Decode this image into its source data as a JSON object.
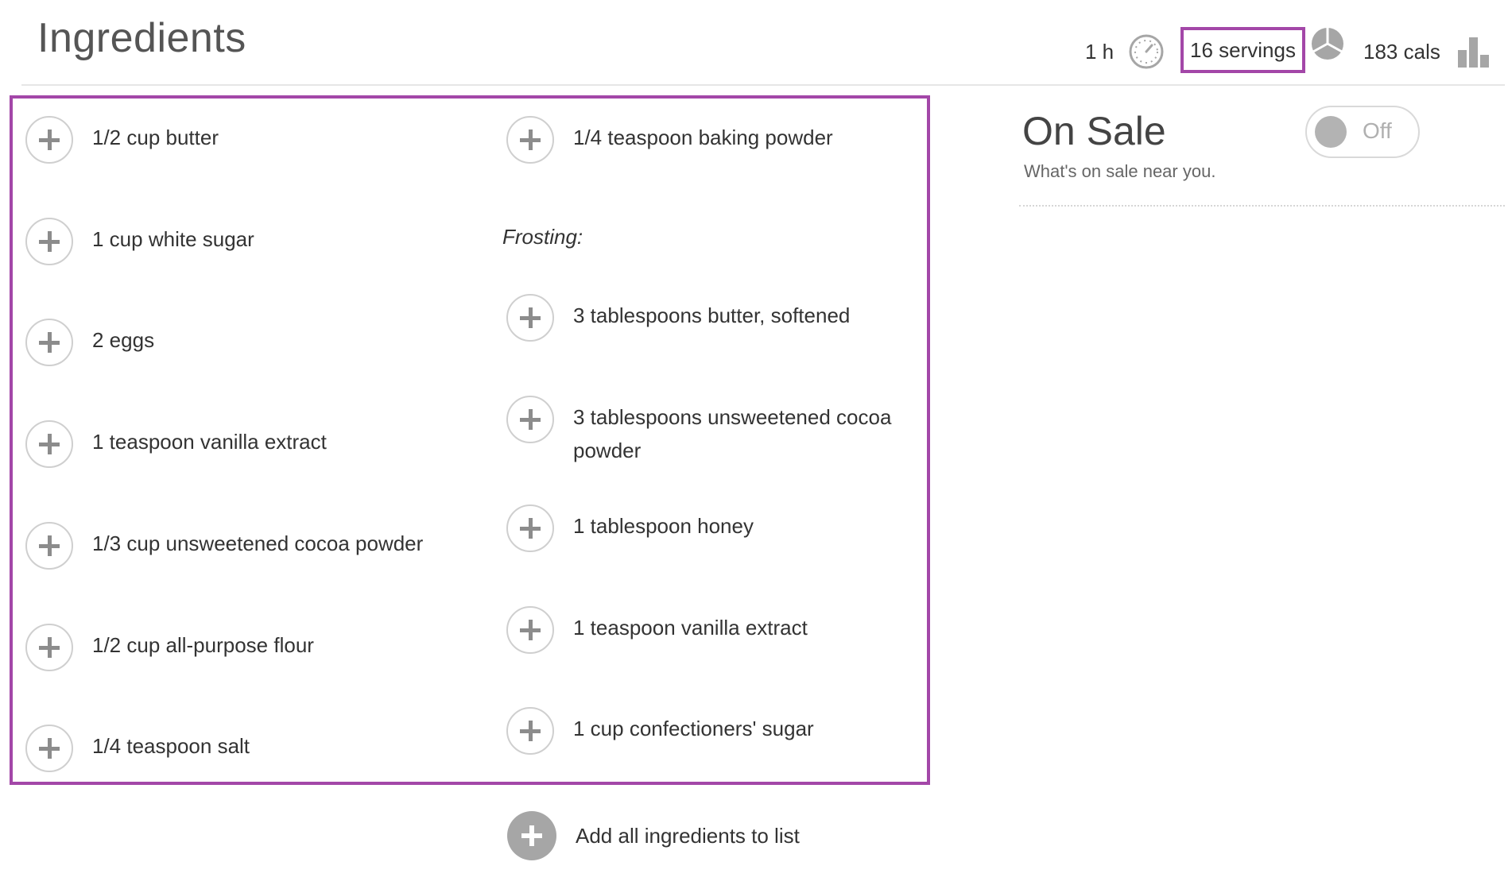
{
  "page_title": "Ingredients",
  "meta": {
    "time": "1 h",
    "servings": "16 servings",
    "calories": "183 cals",
    "icons": [
      "clock-icon",
      "servings-icon",
      "nutrition-bar-icon"
    ]
  },
  "ingredients_left": [
    "1/2 cup butter",
    "1 cup white sugar",
    "2 eggs",
    "1 teaspoon vanilla extract",
    "1/3 cup unsweetened cocoa powder",
    "1/2 cup all-purpose flour",
    "1/4 teaspoon salt"
  ],
  "ingredients_right": {
    "first": "1/4 teaspoon baking powder",
    "section_label": "Frosting:",
    "items": [
      "3 tablespoons butter, softened",
      "3 tablespoons unsweetened cocoa",
      "powder",
      "1 tablespoon honey",
      "1 teaspoon vanilla extract",
      "1 cup confectioners' sugar"
    ]
  },
  "add_all_label": "Add all ingredients to list",
  "on_sale": {
    "title": "On Sale",
    "subtitle": "What's on sale near you.",
    "toggle_state": "Off"
  },
  "colors": {
    "highlight": "#a347a8",
    "icon_gray": "#a6a6a6"
  }
}
